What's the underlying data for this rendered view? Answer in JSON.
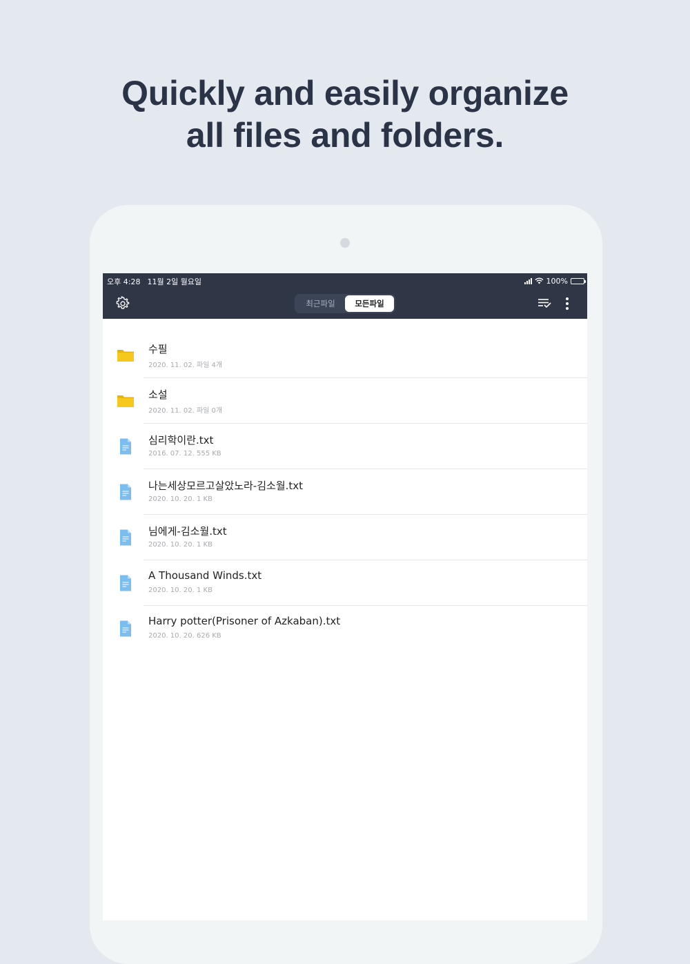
{
  "headline": {
    "line1": "Quickly and easily organize",
    "line2": "all files and folders."
  },
  "status_bar": {
    "time": "오후 4:28",
    "date": "11월 2일 월요일",
    "battery": "100%"
  },
  "toolbar": {
    "tabs": [
      {
        "label": "최근파일",
        "active": false
      },
      {
        "label": "모든파일",
        "active": true
      }
    ]
  },
  "files": [
    {
      "type": "folder",
      "name": "수필",
      "meta": "2020. 11. 02. 파일 4개"
    },
    {
      "type": "folder",
      "name": "소설",
      "meta": "2020. 11. 02. 파일 0개"
    },
    {
      "type": "file",
      "name": "심리학이란.txt",
      "meta": "2016. 07. 12. 555 KB"
    },
    {
      "type": "file",
      "name": "나는세상모르고살았노라-김소월.txt",
      "meta": "2020. 10. 20. 1 KB"
    },
    {
      "type": "file",
      "name": "님에게-김소월.txt",
      "meta": "2020. 10. 20. 1 KB"
    },
    {
      "type": "file",
      "name": "A Thousand Winds.txt",
      "meta": "2020. 10. 20. 1 KB"
    },
    {
      "type": "file",
      "name": "Harry potter(Prisoner of Azkaban).txt",
      "meta": "2020. 10. 20. 626 KB"
    }
  ],
  "colors": {
    "background": "#e4e8ef",
    "headline": "#2b3446",
    "toolbar": "#2f3747",
    "folder": "#f5c518",
    "file": "#7cbdf0"
  }
}
